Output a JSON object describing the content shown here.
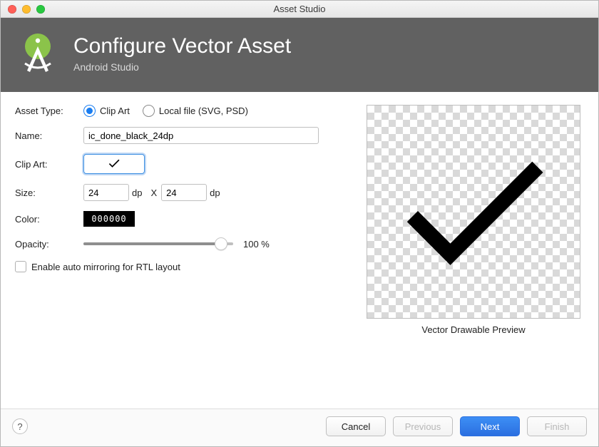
{
  "window": {
    "title": "Asset Studio"
  },
  "banner": {
    "title": "Configure Vector Asset",
    "subtitle": "Android Studio"
  },
  "form": {
    "asset_type": {
      "label": "Asset Type:",
      "options": [
        "Clip Art",
        "Local file (SVG, PSD)"
      ],
      "selected": "Clip Art"
    },
    "name": {
      "label": "Name:",
      "value": "ic_done_black_24dp"
    },
    "clipart": {
      "label": "Clip Art:",
      "icon": "done"
    },
    "size": {
      "label": "Size:",
      "width": "24",
      "height": "24",
      "unit": "dp",
      "x": "X"
    },
    "color": {
      "label": "Color:",
      "hex": "000000"
    },
    "opacity": {
      "label": "Opacity:",
      "value": 100,
      "display": "100 %"
    },
    "rtl": {
      "label": "Enable auto mirroring for RTL layout",
      "checked": false
    }
  },
  "preview": {
    "label": "Vector Drawable Preview"
  },
  "footer": {
    "help": "?",
    "cancel": "Cancel",
    "previous": "Previous",
    "next": "Next",
    "finish": "Finish"
  }
}
